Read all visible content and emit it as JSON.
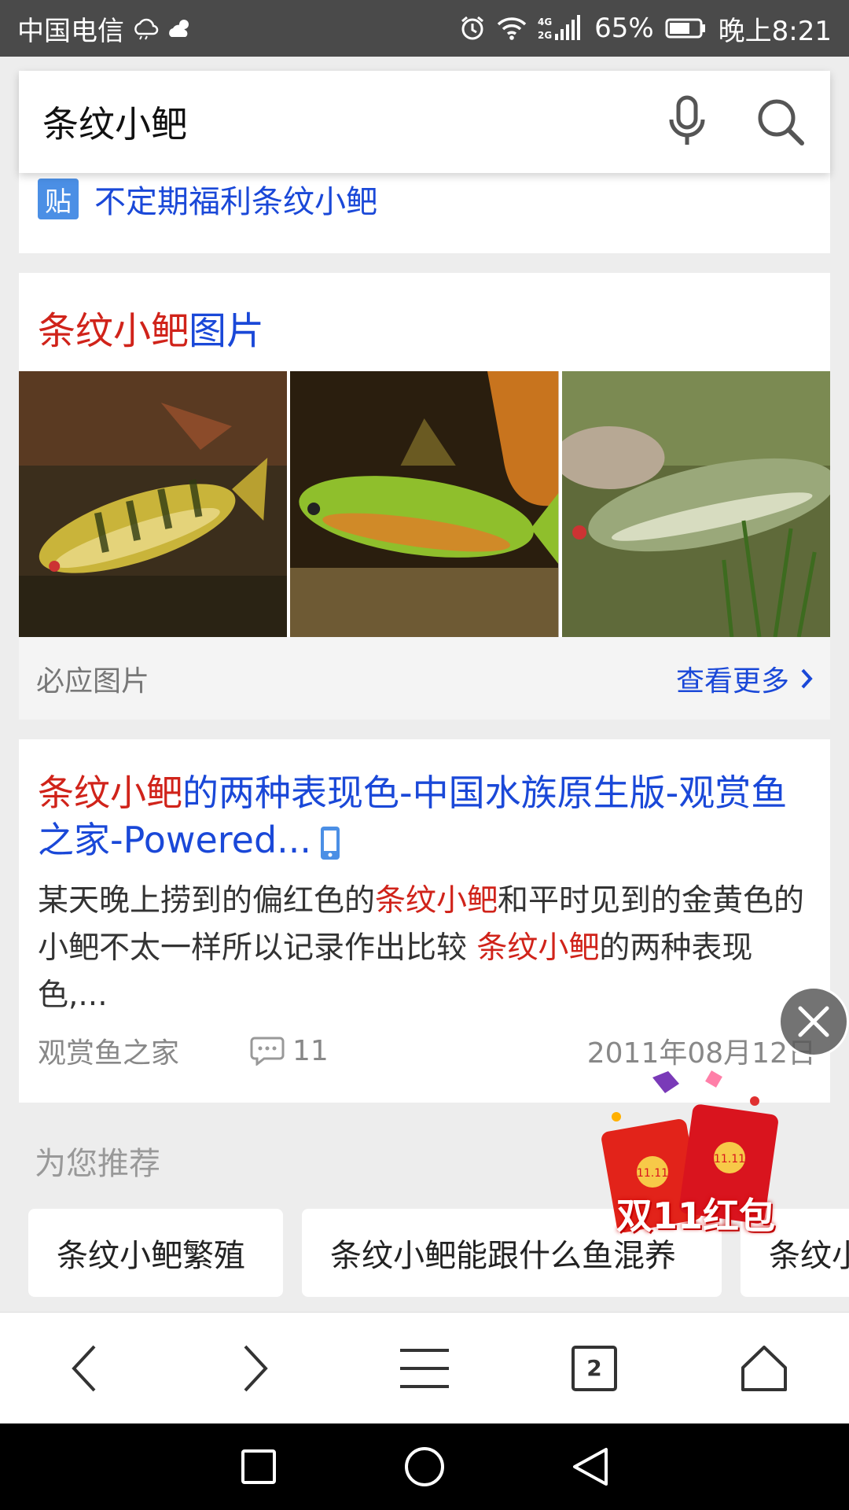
{
  "status_bar": {
    "carrier": "中国电信",
    "battery": "65%",
    "network": "4G 2G",
    "time": "晚上8:21"
  },
  "search": {
    "query": "条纹小鲃"
  },
  "tieba_card": {
    "badge": "贴",
    "link": "不定期福利条纹小鲃"
  },
  "images_card": {
    "title_highlight": "条纹小鲃",
    "title_rest": "图片",
    "source": "必应图片",
    "more": "查看更多"
  },
  "result": {
    "title_highlight": "条纹小鲃",
    "title_rest": "的两种表现色-中国水族原生版-观赏鱼之家-Powered...",
    "snippet_1": "某天晚上捞到的偏红色的",
    "snippet_hl1": "条纹小鲃",
    "snippet_2": "和平时见到的金黄色的小鲃不太一样所以记录作出比较 ",
    "snippet_hl2": "条纹小鲃",
    "snippet_3": "的两种表现色,...",
    "site": "观赏鱼之家",
    "comments": "11",
    "date": "2011年08月12日"
  },
  "recommend": {
    "title": "为您推荐",
    "chips": [
      "条纹小鲃繁殖",
      "条纹小鲃能跟什么鱼混养",
      "条纹小"
    ]
  },
  "promo": {
    "text": "双11红包",
    "envelope_text": "11.11"
  },
  "toolbar": {
    "tab_count": "2"
  },
  "colors": {
    "highlight": "#d0231a",
    "link": "#1a48d8",
    "status_bar": "#4a4a4a"
  }
}
